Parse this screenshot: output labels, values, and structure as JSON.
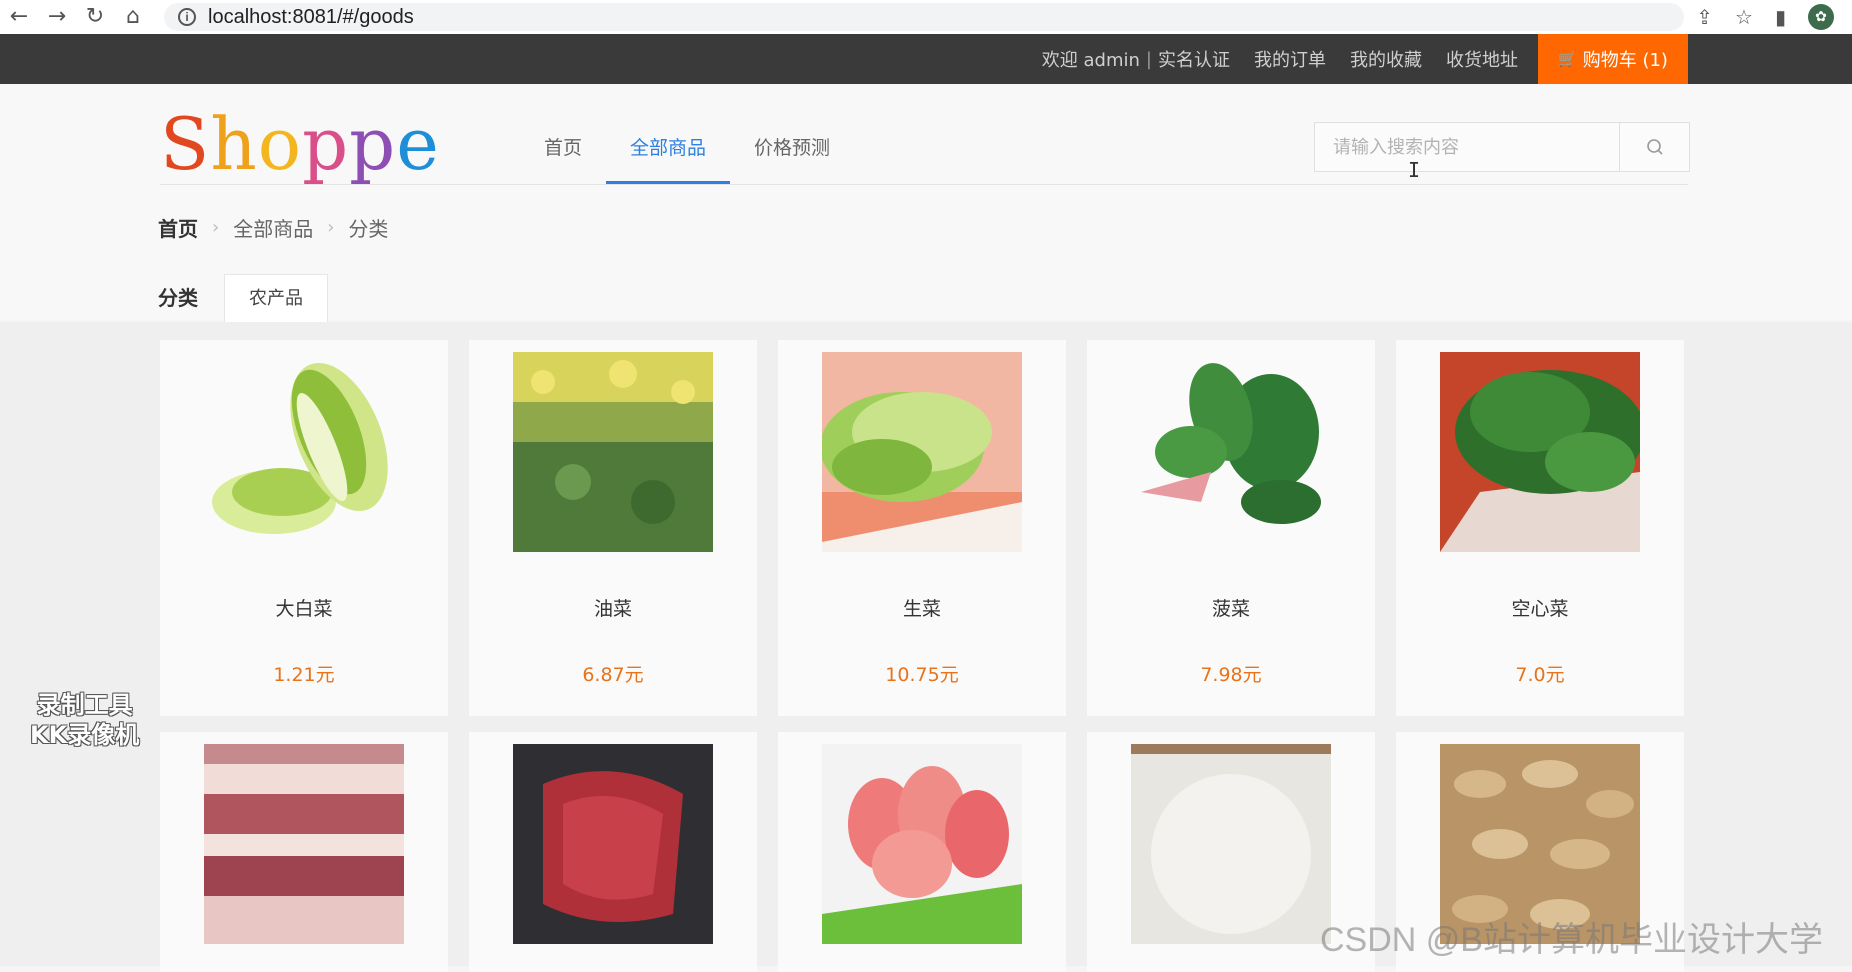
{
  "browser": {
    "url": "localhost:8081/#/goods",
    "back_glyph": "←",
    "forward_glyph": "→",
    "reload_glyph": "↻",
    "home_glyph": "⌂",
    "share_glyph": "⇪",
    "star_glyph": "☆",
    "panel_glyph": "▮",
    "profile_glyph": "✿"
  },
  "topbar": {
    "welcome": "欢迎 admin",
    "separator": "|",
    "verify": "实名认证",
    "orders": "我的订单",
    "favorites": "我的收藏",
    "address": "收货地址",
    "cart_icon": "🛒",
    "cart": "购物车 (1)",
    "accent_color": "#ff6700"
  },
  "logo": {
    "letters": [
      "S",
      "h",
      "o",
      "p",
      "p",
      "e"
    ]
  },
  "nav": {
    "items": [
      {
        "label": "首页"
      },
      {
        "label": "全部商品"
      },
      {
        "label": "价格预测"
      }
    ],
    "active_index": 1,
    "active_color": "#2d80e0"
  },
  "search": {
    "placeholder": "请输入搜索内容",
    "icon": "search-icon"
  },
  "breadcrumb": {
    "home": "首页",
    "level1": "全部商品",
    "level2": "分类",
    "chevron": "›"
  },
  "filter": {
    "label": "分类",
    "chip": "农产品"
  },
  "products": [
    {
      "name": "大白菜",
      "price": "1.21元",
      "image": "napa-cabbage"
    },
    {
      "name": "油菜",
      "price": "6.87元",
      "image": "rapeseed-field"
    },
    {
      "name": "生菜",
      "price": "10.75元",
      "image": "lettuce"
    },
    {
      "name": "菠菜",
      "price": "7.98元",
      "image": "spinach"
    },
    {
      "name": "空心菜",
      "price": "7.0元",
      "image": "water-spinach"
    },
    {
      "name": "",
      "price": "",
      "image": "pork-belly"
    },
    {
      "name": "",
      "price": "",
      "image": "beef-steak"
    },
    {
      "name": "",
      "price": "",
      "image": "sliced-lamb"
    },
    {
      "name": "",
      "price": "",
      "image": "rice"
    },
    {
      "name": "",
      "price": "",
      "image": "peanuts"
    }
  ],
  "price_color": "#e8731b",
  "watermarks": {
    "recorder_line1": "录制工具",
    "recorder_line2": "KK录像机",
    "csdn": "CSDN @B站计算机毕业设计大学"
  }
}
